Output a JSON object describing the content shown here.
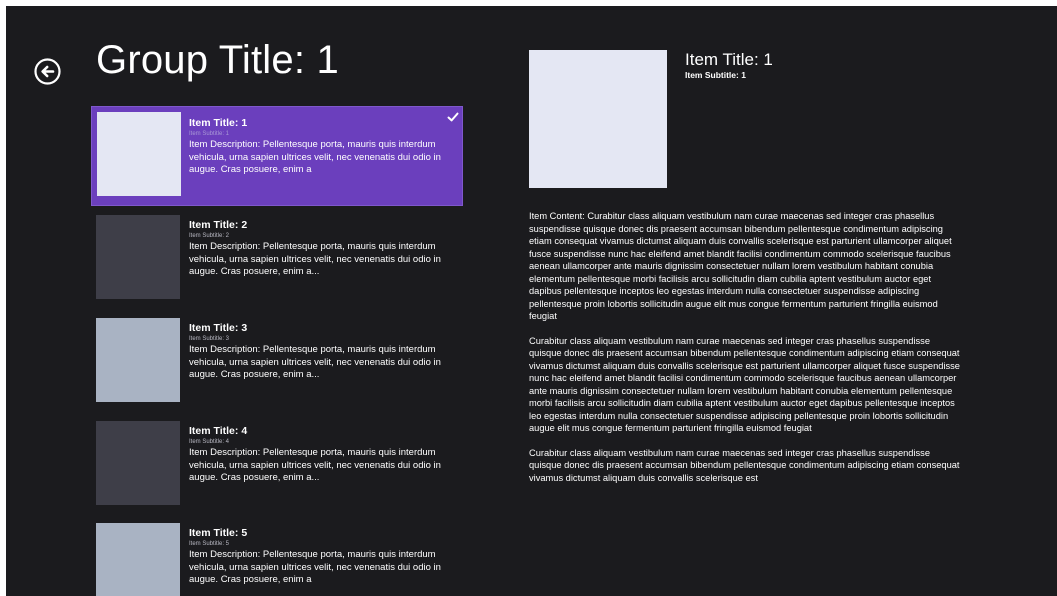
{
  "header": {
    "back_icon": "back-arrow-circle-icon",
    "group_title": "Group Title: 1"
  },
  "colors": {
    "background": "#1b1b1e",
    "selection": "#6b3fbd",
    "thumb_light": "#e4e7f3",
    "thumb_dark": "#3e3e48",
    "thumb_blue": "#a9b3c3"
  },
  "items": [
    {
      "title": "Item Title: 1",
      "subtitle": "Item Subtitle: 1",
      "description": "Item Description: Pellentesque porta, mauris quis interdum vehicula, urna sapien ultrices velit, nec venenatis dui odio in augue. Cras posuere, enim a",
      "selected": true,
      "thumb_color": "#e4e7f3"
    },
    {
      "title": "Item Title: 2",
      "subtitle": "Item Subtitle: 2",
      "description": "Item Description: Pellentesque porta, mauris quis interdum vehicula, urna sapien ultrices velit, nec venenatis dui odio in augue. Cras posuere, enim a...",
      "selected": false,
      "thumb_color": "#3e3e48"
    },
    {
      "title": "Item Title: 3",
      "subtitle": "Item Subtitle: 3",
      "description": "Item Description: Pellentesque porta, mauris quis interdum vehicula, urna sapien ultrices velit, nec venenatis dui odio in augue. Cras posuere, enim a...",
      "selected": false,
      "thumb_color": "#a9b3c3"
    },
    {
      "title": "Item Title: 4",
      "subtitle": "Item Subtitle: 4",
      "description": "Item Description: Pellentesque porta, mauris quis interdum vehicula, urna sapien ultrices velit, nec venenatis dui odio in augue. Cras posuere, enim a...",
      "selected": false,
      "thumb_color": "#3e3e48"
    },
    {
      "title": "Item Title: 5",
      "subtitle": "Item Subtitle: 5",
      "description": "Item Description: Pellentesque porta, mauris quis interdum vehicula, urna sapien ultrices velit, nec venenatis dui odio in augue. Cras posuere, enim a",
      "selected": false,
      "thumb_color": "#a9b3c3"
    }
  ],
  "detail": {
    "title": "Item Title: 1",
    "subtitle": "Item Subtitle: 1",
    "thumb_color": "#e4e7f3",
    "paragraphs": [
      "Item Content: Curabitur class aliquam vestibulum nam curae maecenas sed integer cras phasellus suspendisse quisque donec dis praesent accumsan bibendum pellentesque condimentum adipiscing etiam consequat vivamus dictumst aliquam duis convallis scelerisque est parturient ullamcorper aliquet fusce suspendisse nunc hac eleifend amet blandit facilisi condimentum commodo scelerisque faucibus aenean ullamcorper ante mauris dignissim consectetuer nullam lorem vestibulum habitant conubia elementum pellentesque morbi facilisis arcu sollicitudin diam cubilia aptent vestibulum auctor eget dapibus pellentesque inceptos leo egestas interdum nulla consectetuer suspendisse adipiscing pellentesque proin lobortis sollicitudin augue elit mus congue fermentum parturient fringilla euismod feugiat",
      "Curabitur class aliquam vestibulum nam curae maecenas sed integer cras phasellus suspendisse quisque donec dis praesent accumsan bibendum pellentesque condimentum adipiscing etiam consequat vivamus dictumst aliquam duis convallis scelerisque est parturient ullamcorper aliquet fusce suspendisse nunc hac eleifend amet blandit facilisi condimentum commodo scelerisque faucibus aenean ullamcorper ante mauris dignissim consectetuer nullam lorem vestibulum habitant conubia elementum pellentesque morbi facilisis arcu sollicitudin diam cubilia aptent vestibulum auctor eget dapibus pellentesque inceptos leo egestas interdum nulla consectetuer suspendisse adipiscing pellentesque proin lobortis sollicitudin augue elit mus congue fermentum parturient fringilla euismod feugiat",
      "Curabitur class aliquam vestibulum nam curae maecenas sed integer cras phasellus suspendisse quisque donec dis praesent accumsan bibendum pellentesque condimentum adipiscing etiam consequat vivamus dictumst aliquam duis convallis scelerisque est"
    ]
  }
}
